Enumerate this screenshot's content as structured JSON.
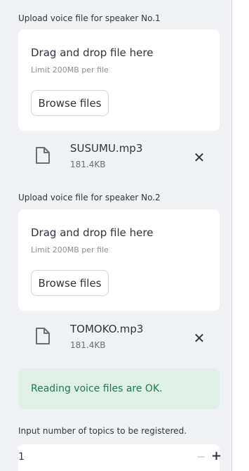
{
  "uploader1": {
    "label": "Upload voice file for speaker No.1",
    "dropzone_title": "Drag and drop file here",
    "limit": "Limit 200MB per file",
    "browse_label": "Browse files",
    "file": {
      "name": "SUSUMU.mp3",
      "size": "181.4KB",
      "icon": "file-icon",
      "remove_icon": "close-icon"
    }
  },
  "uploader2": {
    "label": "Upload voice file for speaker No.2",
    "dropzone_title": "Drag and drop file here",
    "limit": "Limit 200MB per file",
    "browse_label": "Browse files",
    "file": {
      "name": "TOMOKO.mp3",
      "size": "181.4KB",
      "icon": "file-icon",
      "remove_icon": "close-icon"
    }
  },
  "status": {
    "message": "Reading voice files are OK.",
    "background": "#dff0e7",
    "text_color": "#1d7a4b"
  },
  "topics": {
    "label": "Input number of topics to be registered.",
    "value": "1",
    "minus": "−",
    "plus": "+"
  },
  "colors": {
    "sidebar_bg": "#f0f2f6",
    "card_bg": "#ffffff",
    "text": "#31333f"
  }
}
